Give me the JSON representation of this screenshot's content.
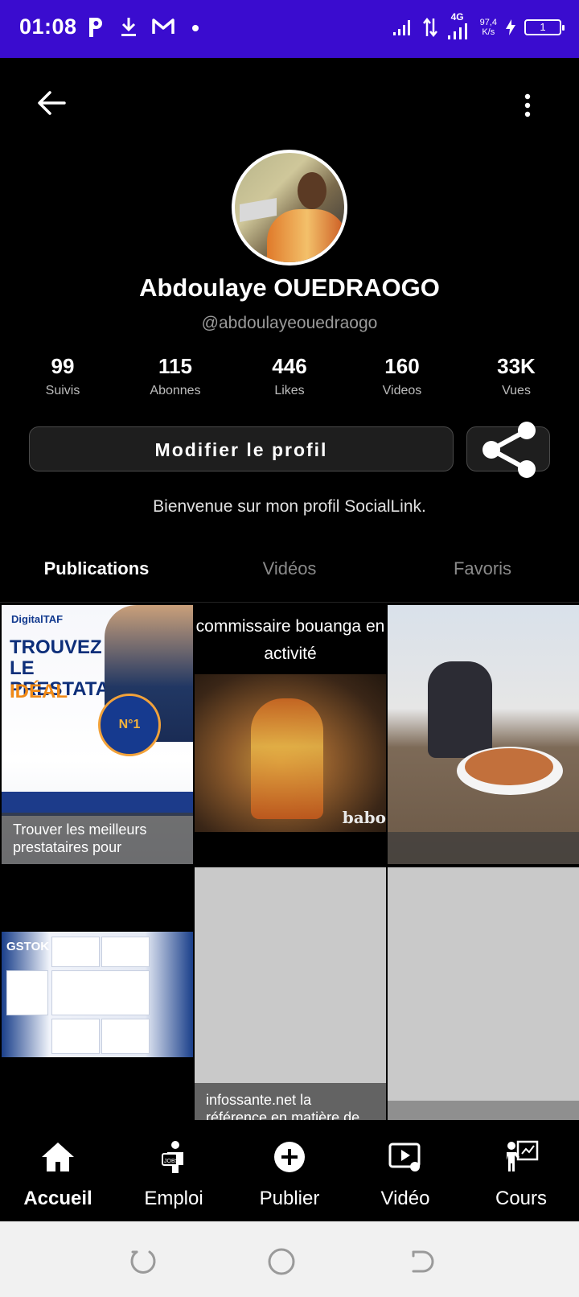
{
  "status_bar": {
    "time": "01:08",
    "network": "4G",
    "speed_value": "97,4",
    "speed_unit": "K/s",
    "battery": "1"
  },
  "profile": {
    "name": "Abdoulaye OUEDRAOGO",
    "handle": "@abdoulayeouedraogo",
    "bio": "Bienvenue sur mon profil SocialLink."
  },
  "stats": [
    {
      "value": "99",
      "label": "Suivis"
    },
    {
      "value": "115",
      "label": "Abonnes"
    },
    {
      "value": "446",
      "label": "Likes"
    },
    {
      "value": "160",
      "label": "Videos"
    },
    {
      "value": "33K",
      "label": "Vues"
    }
  ],
  "buttons": {
    "edit_profile": "Modifier le profil"
  },
  "tabs": [
    {
      "label": "Publications",
      "active": true
    },
    {
      "label": "Vidéos",
      "active": false
    },
    {
      "label": "Favoris",
      "active": false
    }
  ],
  "posts": [
    {
      "caption": "Trouver les meilleurs prestataires pour",
      "image_text": {
        "brand": "DigitalTAF",
        "title": "TROUVEZ LE PRESTATAIRE",
        "highlight": "IDÉAL",
        "badge": "N°1"
      }
    },
    {
      "overlay_text": "commissaire bouanga en activité",
      "watermark": "babo"
    },
    {
      "caption": ""
    },
    {
      "caption": "",
      "image_text": {
        "brand": "GSTOK"
      }
    },
    {
      "caption": "infossante.net la référence en matière de"
    },
    {
      "caption": ""
    }
  ],
  "bottom_nav": [
    {
      "label": "Accueil",
      "icon": "home-icon",
      "active": true
    },
    {
      "label": "Emploi",
      "icon": "jobs-icon",
      "active": false
    },
    {
      "label": "Publier",
      "icon": "plus-circle-icon",
      "active": false
    },
    {
      "label": "Vidéo",
      "icon": "video-icon",
      "active": false
    },
    {
      "label": "Cours",
      "icon": "teacher-icon",
      "active": false
    }
  ],
  "colors": {
    "status_bar": "#3a0ccf",
    "background": "#000000",
    "button_bg": "#1e1e1e",
    "muted_text": "#9a9a9a",
    "system_nav": "#f1f1f1"
  }
}
